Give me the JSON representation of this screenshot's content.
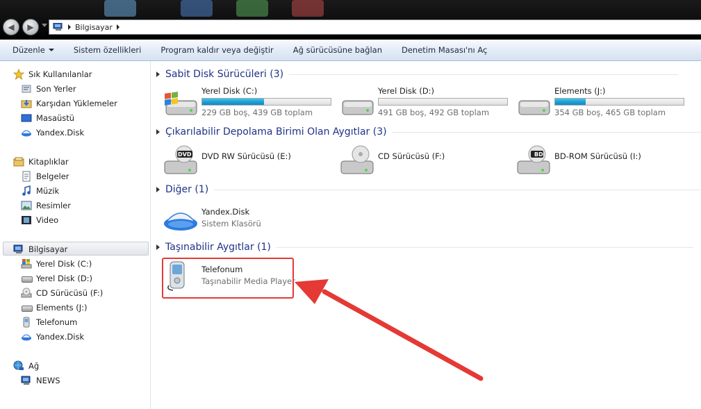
{
  "address": {
    "crumbs": [
      "Bilgisayar"
    ]
  },
  "toolbar": {
    "organize": "Düzenle",
    "system_properties": "Sistem özellikleri",
    "uninstall": "Program kaldır veya değiştir",
    "map_drive": "Ağ sürücüsüne bağlan",
    "control_panel": "Denetim Masası'nı Aç"
  },
  "nav": {
    "favorites": {
      "label": "Sık Kullanılanlar",
      "items": [
        "Son Yerler",
        "Karşıdan Yüklemeler",
        "Masaüstü",
        "Yandex.Disk"
      ]
    },
    "libraries": {
      "label": "Kitaplıklar",
      "items": [
        "Belgeler",
        "Müzik",
        "Resimler",
        "Video"
      ]
    },
    "computer": {
      "label": "Bilgisayar",
      "items": [
        "Yerel Disk (C:)",
        "Yerel Disk (D:)",
        "CD Sürücüsü (F:)",
        "Elements (J:)",
        "Telefonum",
        "Yandex.Disk"
      ]
    },
    "network": {
      "label": "Ağ",
      "items": [
        "NEWS"
      ]
    }
  },
  "groups": {
    "hdd": {
      "title": "Sabit Disk Sürücüleri (3)",
      "items": [
        {
          "name": "Yerel Disk (C:)",
          "info": "229 GB boş, 439 GB toplam",
          "used_fraction": 0.48
        },
        {
          "name": "Yerel Disk (D:)",
          "info": "491 GB boş, 492 GB toplam",
          "used_fraction": 0.002
        },
        {
          "name": "Elements (J:)",
          "info": "354 GB boş, 465 GB toplam",
          "used_fraction": 0.24
        }
      ]
    },
    "removable": {
      "title": "Çıkarılabilir Depolama Birimi Olan Aygıtlar (3)",
      "items": [
        {
          "name": "DVD RW Sürücüsü (E:)",
          "badge": "DVD"
        },
        {
          "name": "CD Sürücüsü (F:)",
          "badge": ""
        },
        {
          "name": "BD-ROM Sürücüsü (I:)",
          "badge": "BD"
        }
      ]
    },
    "other": {
      "title": "Diğer (1)",
      "items": [
        {
          "name": "Yandex.Disk",
          "sub": "Sistem Klasörü"
        }
      ]
    },
    "portable": {
      "title": "Taşınabilir Aygıtlar (1)",
      "items": [
        {
          "name": "Telefonum",
          "sub": "Taşınabilir Media Player"
        }
      ]
    }
  },
  "colors": {
    "annotation": "#e53935",
    "group_title": "#1e3287",
    "bar_fill": "#1da2d8"
  }
}
